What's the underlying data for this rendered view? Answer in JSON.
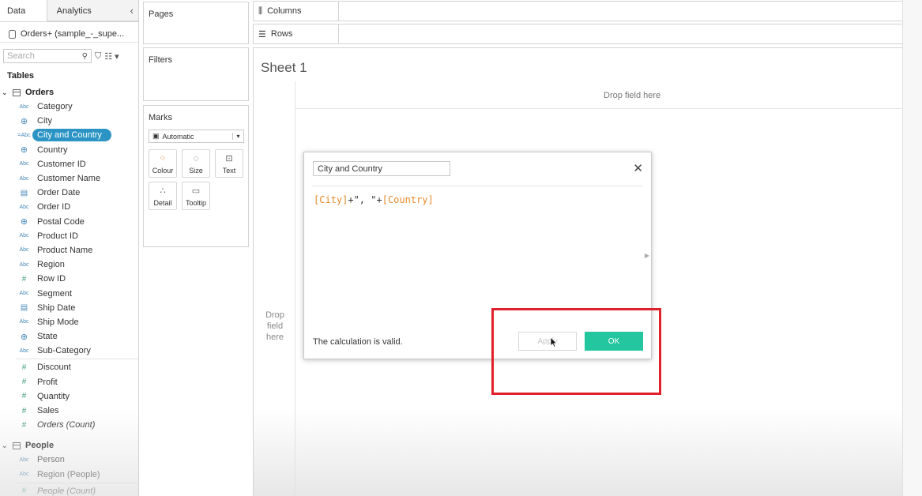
{
  "left_pane": {
    "tabs": [
      "Data",
      "Analytics"
    ],
    "collapse_icon": "‹",
    "datasource": "Orders+ (sample_-_supe...",
    "search_placeholder": "Search",
    "tables_heading": "Tables",
    "groups": [
      {
        "name": "Orders",
        "fields": [
          {
            "label": "Category",
            "type": "Abc"
          },
          {
            "label": "City",
            "type": "geo"
          },
          {
            "label": "City and Country",
            "type": "=Abc",
            "selected": true
          },
          {
            "label": "Country",
            "type": "geo"
          },
          {
            "label": "Customer ID",
            "type": "Abc"
          },
          {
            "label": "Customer Name",
            "type": "Abc"
          },
          {
            "label": "Order Date",
            "type": "date"
          },
          {
            "label": "Order ID",
            "type": "Abc"
          },
          {
            "label": "Postal Code",
            "type": "geo"
          },
          {
            "label": "Product ID",
            "type": "Abc"
          },
          {
            "label": "Product Name",
            "type": "Abc"
          },
          {
            "label": "Region",
            "type": "Abc"
          },
          {
            "label": "Row ID",
            "type": "num"
          },
          {
            "label": "Segment",
            "type": "Abc"
          },
          {
            "label": "Ship Date",
            "type": "date"
          },
          {
            "label": "Ship Mode",
            "type": "Abc"
          },
          {
            "label": "State",
            "type": "geo"
          },
          {
            "label": "Sub-Category",
            "type": "Abc"
          }
        ],
        "measures": [
          {
            "label": "Discount",
            "type": "num"
          },
          {
            "label": "Profit",
            "type": "num"
          },
          {
            "label": "Quantity",
            "type": "num"
          },
          {
            "label": "Sales",
            "type": "num"
          },
          {
            "label": "Orders (Count)",
            "type": "num",
            "italic": true
          }
        ]
      },
      {
        "name": "People",
        "fields": [
          {
            "label": "Person",
            "type": "Abc"
          },
          {
            "label": "Region (People)",
            "type": "Abc"
          }
        ],
        "measures": [
          {
            "label": "People (Count)",
            "type": "num",
            "italic": true
          }
        ]
      }
    ]
  },
  "shelves": {
    "pages": "Pages",
    "filters": "Filters",
    "marks": "Marks",
    "marks_type": "Automatic",
    "mark_buttons": [
      "Colour",
      "Size",
      "Text",
      "Detail",
      "Tooltip"
    ],
    "columns": "Columns",
    "rows": "Rows"
  },
  "sheet": {
    "title": "Sheet 1",
    "drop_field_cols": "Drop field here",
    "drop_field_rows": [
      "Drop",
      "field",
      "here"
    ]
  },
  "dialog": {
    "calc_name": "City and Country",
    "formula_parts": [
      "[City]",
      "+\", \"+",
      "[Country]"
    ],
    "status": "The calculation is valid.",
    "apply_label": "Apply",
    "ok_label": "OK"
  },
  "colors": {
    "selected_pill": "#2b94c5",
    "ok_button": "#23c69e",
    "formula_field": "#e8892b",
    "annotation": "#e0202a"
  }
}
